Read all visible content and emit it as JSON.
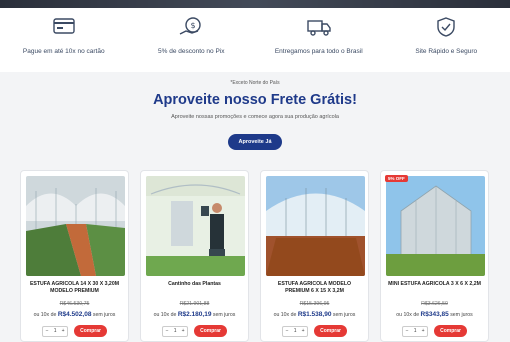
{
  "features": [
    {
      "icon": "credit-card-icon",
      "text": "Pague em até 10x no cartão"
    },
    {
      "icon": "discount-icon",
      "text": "5% de desconto no Pix"
    },
    {
      "icon": "truck-icon",
      "text": "Entregamos para todo o Brasil"
    },
    {
      "icon": "shield-check-icon",
      "text": "Site Rápido e Seguro"
    }
  ],
  "promo": {
    "tag": "*Exceto Norte do País",
    "title": "Aproveite nosso Frete Grátis!",
    "subtitle": "Aproveite nossas promoções e comece agora sua produção agrícola",
    "button": "Aproveite Já"
  },
  "products": [
    {
      "badge": "",
      "name": "ESTUFA AGRICOLA 14 X 30 X 3,20M MODELO PREMIUM",
      "old_price": "R$46.530,75",
      "installments_prefix": "ou 10x de",
      "installment_value": "R$4.502,08",
      "installments_suffix": "sem juros",
      "qty": "1",
      "buy": "Comprar"
    },
    {
      "badge": "",
      "name": "Cantinho das Plantas",
      "old_price": "R$21.901,88",
      "installments_prefix": "ou 10x de",
      "installment_value": "R$2.180,19",
      "installments_suffix": "sem juros",
      "qty": "1",
      "buy": "Comprar"
    },
    {
      "badge": "",
      "name": "ESTUFA AGRICOLA MODELO PREMIUM 6 X 15 X 3,2M",
      "old_price": "R$15.396,95",
      "installments_prefix": "ou 10x de",
      "installment_value": "R$1.538,90",
      "installments_suffix": "sem juros",
      "qty": "1",
      "buy": "Comprar"
    },
    {
      "badge": "5% OFF",
      "name": "MINI ESTUFA AGRICOLA 3 X 6 X 2,2M",
      "old_price": "R$3.626,50",
      "installments_prefix": "ou 10x de",
      "installment_value": "R$343,85",
      "installments_suffix": "sem juros",
      "qty": "1",
      "buy": "Comprar"
    }
  ],
  "colors": {
    "brand_blue": "#1e3a8a",
    "buy_red": "#e53935"
  }
}
